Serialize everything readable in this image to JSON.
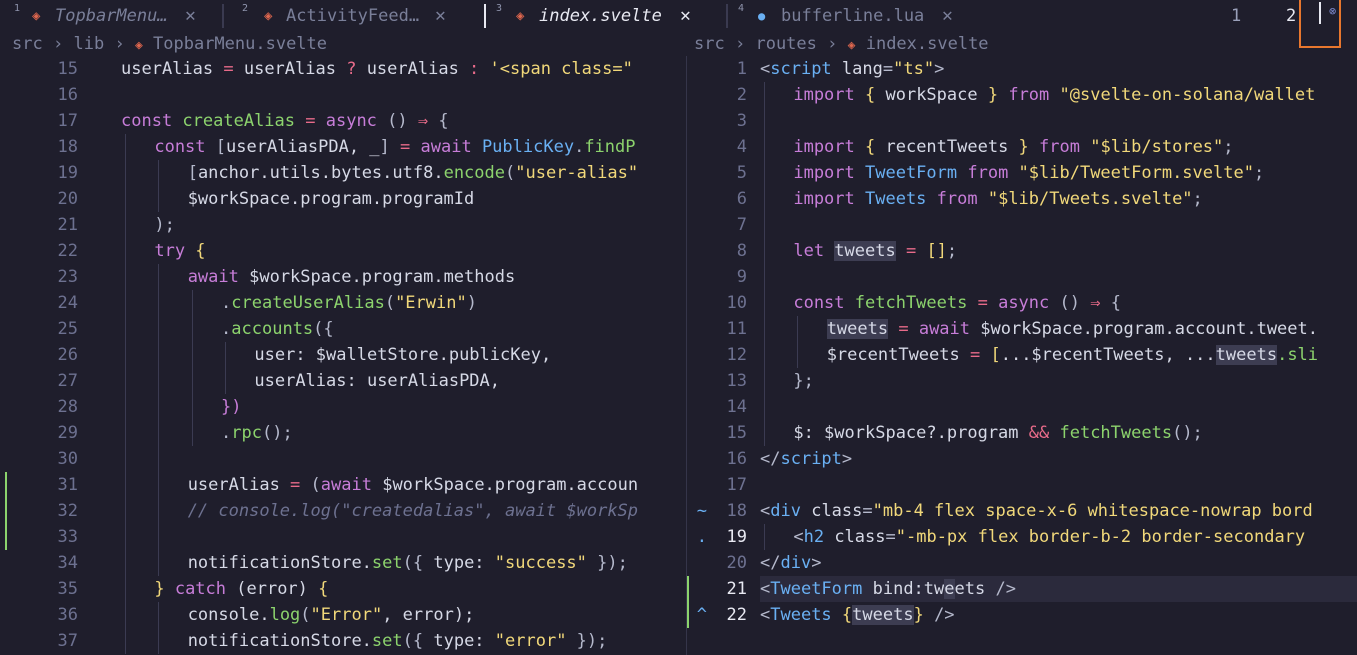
{
  "tabs": [
    {
      "num": "1",
      "icon": "svelte-icon",
      "glyph": "◈",
      "name": "TopbarMenu…",
      "close": "✕",
      "italic": true,
      "active": false
    },
    {
      "num": "2",
      "icon": "svelte-icon",
      "glyph": "◈",
      "name": "ActivityFeed…",
      "close": "✕",
      "italic": false,
      "active": false
    },
    {
      "num": "3",
      "icon": "svelte-icon",
      "glyph": "◈",
      "name": "index.svelte",
      "close": "✕",
      "italic": true,
      "active": true
    },
    {
      "num": "4",
      "icon": "lua-icon",
      "glyph": "●",
      "name": "bufferline.lua",
      "close": "✕",
      "italic": false,
      "active": false
    }
  ],
  "tabpages": [
    "1",
    "2"
  ],
  "close_glyph": "⊗",
  "left_breadcrumb": [
    "src",
    "lib",
    "TopbarMenu.svelte"
  ],
  "right_breadcrumb": [
    "src",
    "routes",
    "index.svelte"
  ],
  "breadcrumb_sep": "›",
  "left_pane": {
    "numbers": [
      "15",
      "16",
      "17",
      "18",
      "19",
      "20",
      "21",
      "22",
      "23",
      "24",
      "25",
      "26",
      "27",
      "28",
      "29",
      "30",
      "31",
      "32",
      "33",
      "34",
      "35",
      "36",
      "37"
    ],
    "lines": [
      [
        [
          "userAlias",
          "fg"
        ],
        [
          " = ",
          "op"
        ],
        [
          "userAlias",
          "fg"
        ],
        [
          " ? ",
          "op"
        ],
        [
          "userAlias",
          "fg"
        ],
        [
          " : ",
          "op"
        ],
        [
          "'<span class=\"",
          "str"
        ]
      ],
      [],
      [
        [
          "const ",
          "kw"
        ],
        [
          "createAlias",
          "fn"
        ],
        [
          " = ",
          "op"
        ],
        [
          "async ",
          "kw"
        ],
        [
          "() ",
          "pun"
        ],
        [
          "⇒ ",
          "op"
        ],
        [
          "{",
          "pun"
        ]
      ],
      [
        [
          "const ",
          "kw"
        ],
        [
          "[",
          "pun"
        ],
        [
          "userAliasPDA, _",
          "fg"
        ],
        [
          "] ",
          "pun"
        ],
        [
          "= ",
          "op"
        ],
        [
          "await ",
          "kw"
        ],
        [
          "PublicKey",
          "ty"
        ],
        [
          ".",
          "pun"
        ],
        [
          "findP",
          "fn"
        ]
      ],
      [
        [
          "[",
          "pun"
        ],
        [
          "anchor.utils.bytes.utf8.",
          "fg"
        ],
        [
          "encode",
          "fn"
        ],
        [
          "(",
          "pun"
        ],
        [
          "\"user-alias\"",
          "str"
        ]
      ],
      [
        [
          "$workSpace.program.programId",
          "fg"
        ]
      ],
      [
        [
          "); ",
          "pun"
        ]
      ],
      [
        [
          "try ",
          "kw"
        ],
        [
          "{",
          "str"
        ]
      ],
      [
        [
          "await ",
          "kw"
        ],
        [
          "$workSpace.program.methods",
          "fg"
        ]
      ],
      [
        [
          ".",
          "pun"
        ],
        [
          "createUserAlias",
          "fn"
        ],
        [
          "(",
          "pun"
        ],
        [
          "\"Erwin\"",
          "str"
        ],
        [
          ")",
          "pun"
        ]
      ],
      [
        [
          ".",
          "pun"
        ],
        [
          "accounts",
          "fn"
        ],
        [
          "({",
          "pun"
        ]
      ],
      [
        [
          "user: $walletStore.publicKey,",
          "fg"
        ]
      ],
      [
        [
          "userAlias: userAliasPDA,",
          "fg"
        ]
      ],
      [
        [
          "})",
          "kw"
        ]
      ],
      [
        [
          ".",
          "pun"
        ],
        [
          "rpc",
          "fn"
        ],
        [
          "();",
          "pun"
        ]
      ],
      [],
      [
        [
          "userAlias ",
          "fg"
        ],
        [
          "= ",
          "op"
        ],
        [
          "(",
          "pun"
        ],
        [
          "await ",
          "kw"
        ],
        [
          "$workSpace.program.accoun",
          "fg"
        ]
      ],
      [
        [
          "// console.log(\"createdalias\", await $workSp",
          "cm"
        ]
      ],
      [],
      [
        [
          "notificationStore.",
          "fg"
        ],
        [
          "set",
          "fn"
        ],
        [
          "({ ",
          "pun"
        ],
        [
          "type: ",
          "fg"
        ],
        [
          "\"success\"",
          "str"
        ],
        [
          " });",
          "pun"
        ]
      ],
      [
        [
          "} ",
          "str"
        ],
        [
          "catch ",
          "kw"
        ],
        [
          "(error) ",
          "fg"
        ],
        [
          "{",
          "str"
        ]
      ],
      [
        [
          "console.",
          "fg"
        ],
        [
          "log",
          "fn"
        ],
        [
          "(",
          "pun"
        ],
        [
          "\"Error\"",
          "str"
        ],
        [
          ", error);",
          "fg"
        ]
      ],
      [
        [
          "notificationStore.",
          "fg"
        ],
        [
          "set",
          "fn"
        ],
        [
          "({ ",
          "pun"
        ],
        [
          "type: ",
          "fg"
        ],
        [
          "\"error\"",
          "str"
        ],
        [
          " });",
          "pun"
        ]
      ]
    ]
  },
  "right_pane": {
    "numbers": [
      "1",
      "2",
      "3",
      "4",
      "5",
      "6",
      "7",
      "8",
      "9",
      "10",
      "11",
      "12",
      "13",
      "14",
      "15",
      "16",
      "17",
      "18",
      "19",
      "20",
      "21",
      "22"
    ],
    "gutter_signs": {
      "18": "~",
      "19": ".",
      "21": "",
      "22": "^"
    },
    "lines": [
      [
        [
          "<",
          "pun"
        ],
        [
          "script ",
          "tag"
        ],
        [
          "lang",
          "fg"
        ],
        [
          "=",
          "pun"
        ],
        [
          "\"ts\"",
          "str"
        ],
        [
          ">",
          "pun"
        ]
      ],
      [
        [
          "import ",
          "kw"
        ],
        [
          "{ ",
          "str"
        ],
        [
          "workSpace ",
          "fg"
        ],
        [
          "} ",
          "str"
        ],
        [
          "from ",
          "kw"
        ],
        [
          "\"@svelte-on-solana/wallet",
          "str"
        ]
      ],
      [],
      [
        [
          "import ",
          "kw"
        ],
        [
          "{ ",
          "str"
        ],
        [
          "recentTweets ",
          "fg"
        ],
        [
          "} ",
          "str"
        ],
        [
          "from ",
          "kw"
        ],
        [
          "\"$lib/stores\"",
          "str"
        ],
        [
          ";",
          "pun"
        ]
      ],
      [
        [
          "import ",
          "kw"
        ],
        [
          "TweetForm ",
          "ty"
        ],
        [
          "from ",
          "kw"
        ],
        [
          "\"$lib/TweetForm.svelte\"",
          "str"
        ],
        [
          ";",
          "pun"
        ]
      ],
      [
        [
          "import ",
          "kw"
        ],
        [
          "Tweets ",
          "ty"
        ],
        [
          "from ",
          "kw"
        ],
        [
          "\"$lib/Tweets.svelte\"",
          "str"
        ],
        [
          ";",
          "pun"
        ]
      ],
      [],
      [
        [
          "let ",
          "kw"
        ],
        [
          "tweets",
          "hl"
        ],
        [
          " = ",
          "op"
        ],
        [
          "[]",
          "str"
        ],
        [
          ";",
          "pun"
        ]
      ],
      [],
      [
        [
          "const ",
          "kw"
        ],
        [
          "fetchTweets",
          "fn"
        ],
        [
          " = ",
          "op"
        ],
        [
          "async ",
          "kw"
        ],
        [
          "() ",
          "pun"
        ],
        [
          "⇒ ",
          "op"
        ],
        [
          "{",
          "pun"
        ]
      ],
      [
        [
          "tweets",
          "hl"
        ],
        [
          " = ",
          "op"
        ],
        [
          "await ",
          "kw"
        ],
        [
          "$workSpace.program.account.tweet.",
          "fg"
        ]
      ],
      [
        [
          "$recentTweets ",
          "fg"
        ],
        [
          "= ",
          "op"
        ],
        [
          "[",
          "str"
        ],
        [
          "...$recentTweets, ...",
          "fg"
        ],
        [
          "tweets",
          "hl"
        ],
        [
          ".sli",
          "fn"
        ]
      ],
      [
        [
          "};",
          "pun"
        ]
      ],
      [],
      [
        [
          "$: $workSpace?.",
          "fg"
        ],
        [
          "program ",
          "fg"
        ],
        [
          "&& ",
          "op"
        ],
        [
          "fetchTweets",
          "fn"
        ],
        [
          "();",
          "pun"
        ]
      ],
      [
        [
          "</",
          "pun"
        ],
        [
          "script",
          "tag"
        ],
        [
          ">",
          "pun"
        ]
      ],
      [],
      [
        [
          "<",
          "pun"
        ],
        [
          "div ",
          "tag"
        ],
        [
          "class",
          "fg"
        ],
        [
          "=",
          "pun"
        ],
        [
          "\"mb-4 flex space-x-6 whitespace-nowrap bord",
          "str"
        ]
      ],
      [
        [
          "<",
          "pun"
        ],
        [
          "h2 ",
          "tag"
        ],
        [
          "class",
          "fg"
        ],
        [
          "=",
          "pun"
        ],
        [
          "\"-mb-px flex border-b-2 border-secondary",
          "str"
        ]
      ],
      [
        [
          "</",
          "pun"
        ],
        [
          "div",
          "tag"
        ],
        [
          ">",
          "pun"
        ]
      ],
      [
        [
          "<",
          "pun"
        ],
        [
          "TweetForm ",
          "tag"
        ],
        [
          "bind:tw",
          "fg"
        ],
        [
          "e",
          "hl"
        ],
        [
          "ets ",
          "fg"
        ],
        [
          "/>",
          "pun"
        ]
      ],
      [
        [
          "<",
          "pun"
        ],
        [
          "Tweets ",
          "tag"
        ],
        [
          "{",
          "str"
        ],
        [
          "tweets",
          "hl"
        ],
        [
          "} ",
          "str"
        ],
        [
          "/>",
          "pun"
        ]
      ]
    ]
  }
}
